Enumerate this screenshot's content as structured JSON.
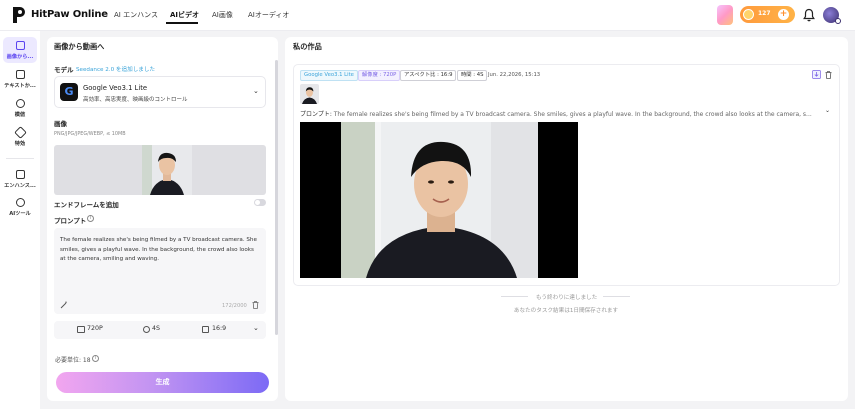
{
  "header": {
    "brand": "HitPaw Online",
    "tabs": [
      {
        "label": "AI エンハンス"
      },
      {
        "label": "AIビデオ"
      },
      {
        "label": "AI画像"
      },
      {
        "label": "AIオーディオ"
      }
    ],
    "active_tab": "AIビデオ",
    "credits": "127",
    "accent": "#5b45f0"
  },
  "sidebar": {
    "items": [
      {
        "label": "画像から...",
        "icon": "image-to-video-icon"
      },
      {
        "label": "テキストか...",
        "icon": "text-to-video-icon"
      },
      {
        "label": "模倣",
        "icon": "imitate-icon"
      },
      {
        "label": "特効",
        "icon": "effects-icon"
      },
      {
        "label": "エンハンス...",
        "icon": "enhance-icon"
      },
      {
        "label": "AIツール",
        "icon": "ai-tools-icon"
      }
    ]
  },
  "left": {
    "title": "画像から動画へ",
    "model_label": "モデル",
    "model_note": "Seedance 2.0 を追加しました",
    "model_name": "Google Veo3.1 Lite",
    "model_desc": "高効率、高忠実度、映画級のコントロール",
    "image_label": "画像",
    "image_formats": "PNG/JPG/JPEG/WEBP, ≤ 10MB",
    "end_frame_label": "エンドフレームを追加",
    "prompt_label": "プロンプト",
    "prompt_text": "The female realizes she's being filmed by a TV broadcast camera. She smiles, gives a playful wave. In the background, the crowd also looks at the camera, smiling and waving.",
    "char_count": "172/2000",
    "settings": {
      "resolution": "720P",
      "duration": "4S",
      "aspect": "16:9"
    },
    "required_units": "必要単位: 18",
    "generate_label": "生成"
  },
  "right": {
    "title": "私の作品",
    "tags": {
      "model": "Google Veo3.1 Lite",
      "resolution": "解像度 : 720P",
      "aspect": "アスペクト比 : 16:9",
      "time": "時間 : 4S"
    },
    "date": "Jun. 22,2026, 15:13",
    "prompt_prefix": "プロンプト:",
    "prompt": "The female realizes she's being filmed by a TV broadcast camera. She smiles, gives a playful wave. In the background, the crowd also looks at the camera, s...",
    "end_main": "もう終わりに達しました",
    "end_sub": "あなたのタスク結果は1日間保存されます"
  }
}
